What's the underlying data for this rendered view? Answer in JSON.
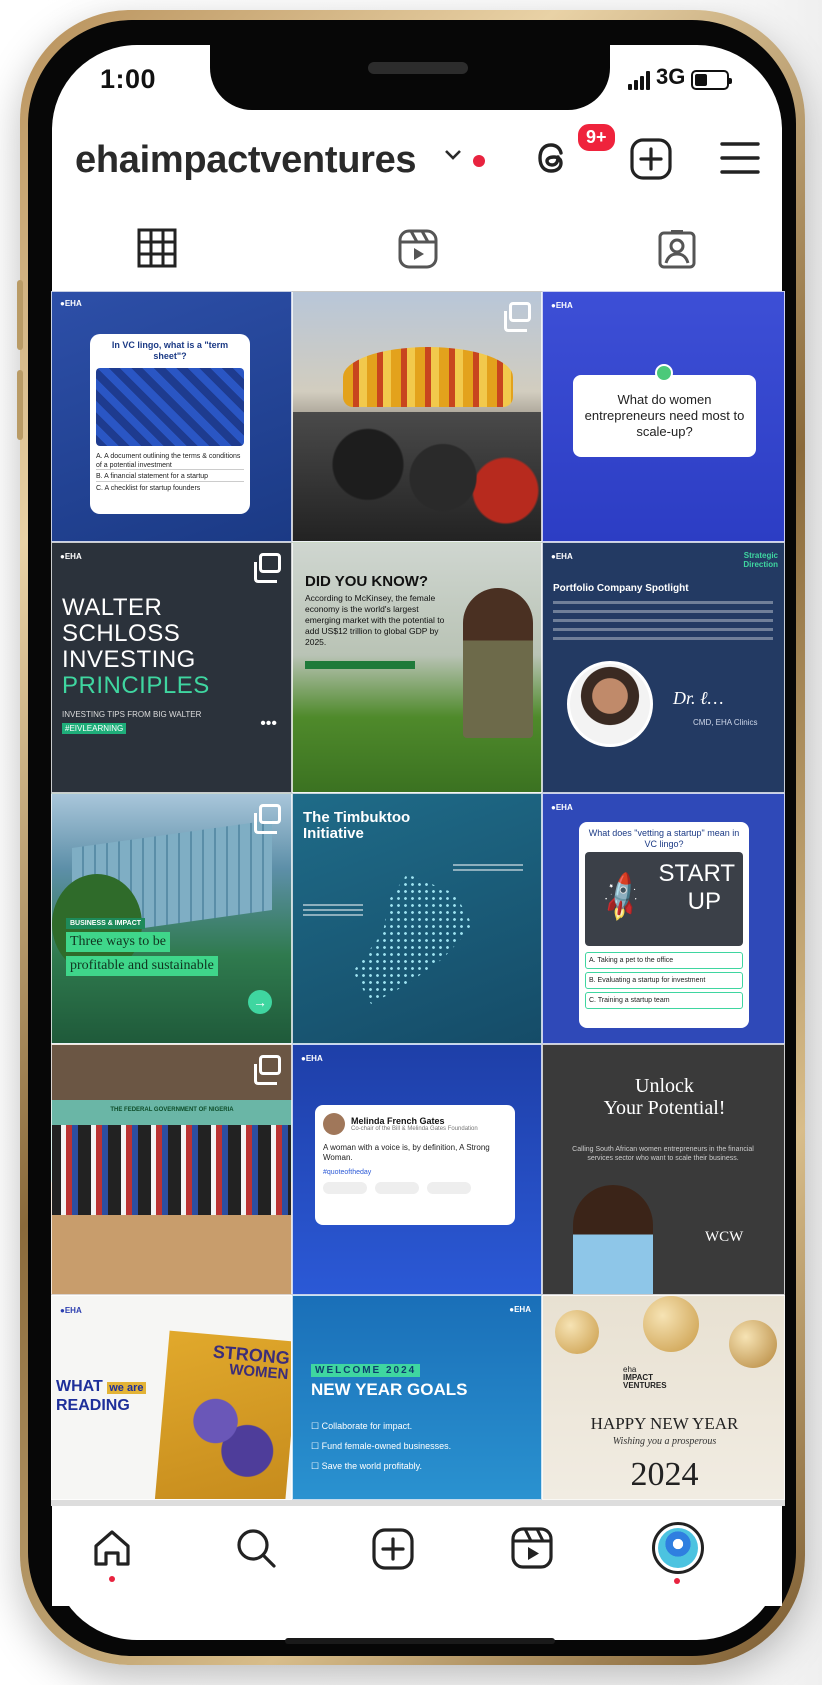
{
  "status_bar": {
    "time": "1:00",
    "network": "3G"
  },
  "header": {
    "username": "ehaimpactventures",
    "threads_badge": "9+"
  },
  "tabs": {
    "grid": "grid-icon",
    "reels": "reels-icon",
    "tagged": "tagged-icon"
  },
  "posts": {
    "p1": {
      "q": "In VC lingo, what is a \"term sheet\"?",
      "a": "A. A document outlining the terms & conditions of a potential investment",
      "b": "B. A financial statement for a startup",
      "c": "C. A checklist for startup founders"
    },
    "p3": {
      "q": "What do women entrepreneurs need most to scale-up?"
    },
    "p4": {
      "l1": "WALTER",
      "l2": "SCHLOSS",
      "l3": "INVESTING",
      "l4": "PRINCIPLES",
      "sub": "INVESTING TIPS FROM BIG WALTER",
      "tag": "#EIVLEARNING"
    },
    "p5": {
      "title": "DID YOU KNOW?",
      "body": "According to McKinsey, the female economy is the world's largest emerging market with the potential to add US$12 trillion to global GDP by 2025."
    },
    "p6": {
      "title": "Portfolio Company Spotlight",
      "tag": "Strategic Direction",
      "role": "CMD, EHA Clinics"
    },
    "p7": {
      "tag": "BUSINESS & IMPACT",
      "l1": "Three ways to be",
      "l2": "profitable and sustainable"
    },
    "p8": {
      "title": "The Timbuktoo Initiative"
    },
    "p9": {
      "q": "What does \"vetting a startup\" mean in VC lingo?",
      "w1": "START",
      "w2": "UP",
      "a": "A. Taking a pet to the office",
      "b": "B. Evaluating a startup for investment",
      "c": "C. Training a startup team"
    },
    "p10": {
      "banner": "THE FEDERAL GOVERNMENT OF NIGERIA"
    },
    "p11": {
      "name": "Melinda French Gates",
      "role": "Co-chair of the Bill & Melinda Gates Foundation",
      "quote": "A woman with a voice is, by definition, A Strong Woman.",
      "tag": "#quoteoftheday"
    },
    "p12": {
      "l1": "Unlock",
      "l2": "Your Potential!",
      "body": "Calling South African women entrepreneurs in the financial services sector who want to scale their business.",
      "wcw": "WCW"
    },
    "p13": {
      "what": "WHAT",
      "weare": "we are",
      "reading": "READING",
      "book1": "STRONG",
      "book2": "WOMEN"
    },
    "p14": {
      "tag": "WELCOME 2024",
      "title": "NEW YEAR GOALS",
      "i1": "Collaborate for impact.",
      "i2": "Fund female-owned businesses.",
      "i3": "Save the world profitably."
    },
    "p15": {
      "brand1": "eha",
      "brand2": "IMPACT",
      "brand3": "VENTURES",
      "title": "HAPPY NEW YEAR",
      "sub": "Wishing you a prosperous",
      "year": "2024"
    }
  },
  "bottom_nav": [
    "home-icon",
    "search-icon",
    "create-icon",
    "reels-icon",
    "profile-avatar"
  ]
}
